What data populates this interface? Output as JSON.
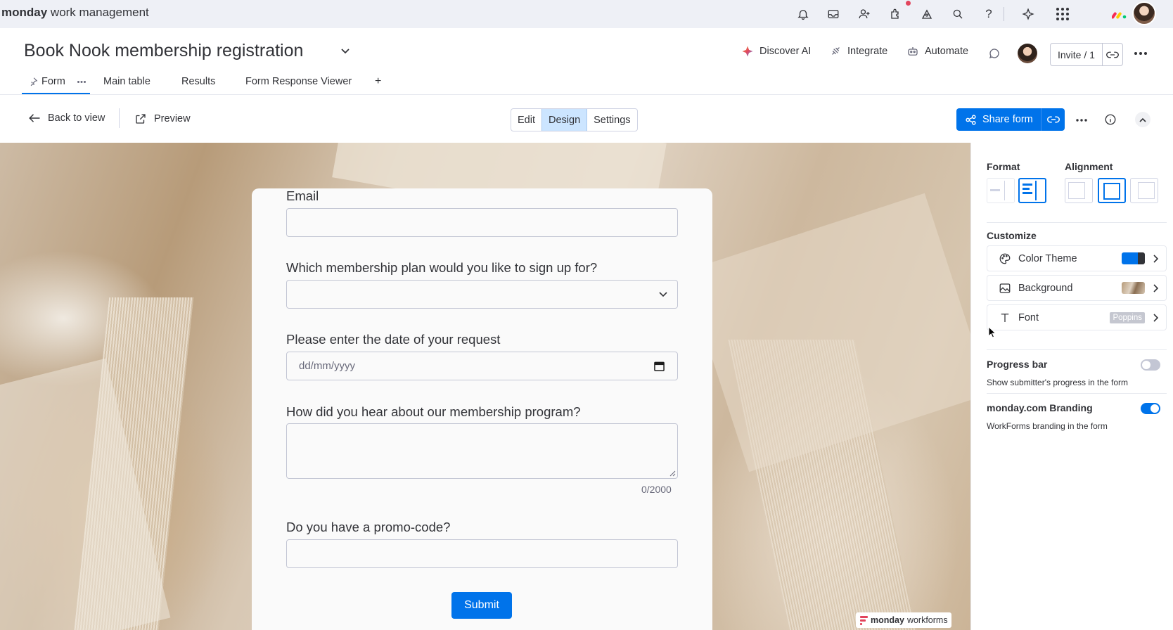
{
  "brand": {
    "bold": "monday",
    "rest": " work management"
  },
  "top_icons": [
    "bell-icon",
    "inbox-icon",
    "invite-members-icon",
    "apps-icon",
    "templates-icon",
    "search-icon",
    "help-icon",
    "ai-sparkle-icon",
    "app-switcher-icon",
    "monday-logo-icon",
    "avatar"
  ],
  "board": {
    "title": "Book Nook membership registration",
    "actions": {
      "discover_ai": "Discover AI",
      "integrate": "Integrate",
      "automate": "Automate"
    },
    "invite_label": "Invite / 1"
  },
  "tabs": [
    {
      "label": "Form",
      "active": true
    },
    {
      "label": "Main table"
    },
    {
      "label": "Results"
    },
    {
      "label": "Form Response Viewer"
    }
  ],
  "tab_add": "+",
  "toolbar": {
    "back": "Back to view",
    "preview": "Preview",
    "segments": [
      "Edit",
      "Design",
      "Settings"
    ],
    "active_segment": "Design",
    "share": "Share form"
  },
  "form": {
    "questions": [
      {
        "label": "Email",
        "type": "text",
        "placeholder": ""
      },
      {
        "label": "Which membership plan would you like to sign up for?",
        "type": "dropdown",
        "value": ""
      },
      {
        "label": "Please enter the date of your request",
        "type": "date",
        "placeholder": "dd/mm/yyyy"
      },
      {
        "label": "How did you hear about our membership program?",
        "type": "textarea",
        "counter": "0/2000"
      },
      {
        "label": "Do you have a promo-code?",
        "type": "text",
        "placeholder": ""
      }
    ],
    "submit": "Submit",
    "branding": {
      "bold": "monday",
      "rest": " workforms"
    }
  },
  "panel": {
    "format_label": "Format",
    "alignment_label": "Alignment",
    "customize_label": "Customize",
    "customize": [
      {
        "label": "Color Theme",
        "icon": "palette-icon"
      },
      {
        "label": "Background",
        "icon": "image-icon"
      },
      {
        "label": "Font",
        "icon": "text-icon",
        "value": "Poppins"
      }
    ],
    "progress_bar": {
      "label": "Progress bar",
      "sub": "Show submitter's progress in the form",
      "enabled": false
    },
    "branding": {
      "label": "monday.com Branding",
      "sub": "WorkForms branding in the form",
      "enabled": true
    }
  },
  "colors": {
    "accent": "#0073ea",
    "theme_swatch": "#0073ea",
    "toggle_off": "#c3c6d4"
  }
}
